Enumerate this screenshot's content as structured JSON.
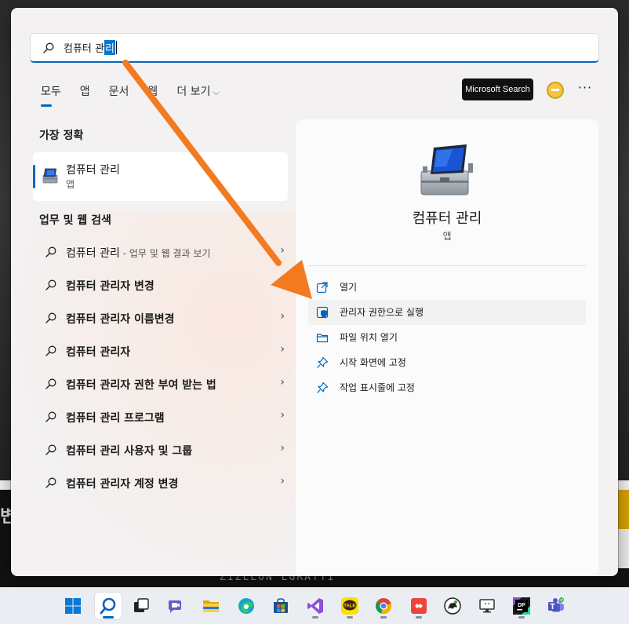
{
  "search": {
    "query_prefix": "컴퓨터 관",
    "query_selected": "리"
  },
  "tabs": [
    {
      "label": "모두",
      "active": true
    },
    {
      "label": "앱",
      "active": false
    },
    {
      "label": "문서",
      "active": false
    },
    {
      "label": "웹",
      "active": false
    },
    {
      "label": "더 보기",
      "active": false,
      "chevron": "⌵"
    }
  ],
  "header": {
    "ms_search_label": "Microsoft Search",
    "more_label": "···"
  },
  "best_match": {
    "section_title": "가장 정확",
    "title": "컴퓨터 관리",
    "subtitle": "앱"
  },
  "web_search": {
    "section_title": "업무 및 웹 검색",
    "items": [
      {
        "label": "컴퓨터 관리",
        "extra": " - 업무 및 웹 결과 보기",
        "bold": false
      },
      {
        "label": "컴퓨터 관리자 변경",
        "extra": "",
        "bold": true
      },
      {
        "label": "컴퓨터 관리자 이름변경",
        "extra": "",
        "bold": true
      },
      {
        "label": "컴퓨터 관리자",
        "extra": "",
        "bold": true
      },
      {
        "label": "컴퓨터 관리자 권한 부여 받는 법",
        "extra": "",
        "bold": true
      },
      {
        "label": "컴퓨터 관리 프로그램",
        "extra": "",
        "bold": true
      },
      {
        "label": "컴퓨터 관리 사용자 및 그룹",
        "extra": "",
        "bold": true
      },
      {
        "label": "컴퓨터 관리자 계정 변경",
        "extra": "",
        "bold": true
      }
    ],
    "arrow_glyph": "›"
  },
  "preview": {
    "title": "컴퓨터 관리",
    "subtitle": "앱",
    "actions": [
      {
        "label": "열기",
        "icon": "open-external-icon"
      },
      {
        "label": "관리자 권한으로 실행",
        "icon": "admin-shield-icon"
      },
      {
        "label": "파일 위치 열기",
        "icon": "folder-icon"
      },
      {
        "label": "시작 화면에 고정",
        "icon": "pin-icon"
      },
      {
        "label": "작업 표시줄에 고정",
        "icon": "pin-icon"
      }
    ]
  },
  "background": {
    "left_glyphs": "변",
    "bottom_text": "ZIZLLON LGRATTI"
  },
  "taskbar": {
    "items": [
      {
        "name": "start-button",
        "icon": "windows-logo-icon"
      },
      {
        "name": "search-button",
        "icon": "search-icon",
        "active": true
      },
      {
        "name": "task-view-button",
        "icon": "task-view-icon"
      },
      {
        "name": "chat-button",
        "icon": "video-chat-icon"
      },
      {
        "name": "file-explorer-button",
        "icon": "folder-icon"
      },
      {
        "name": "edge-button",
        "icon": "edge-icon"
      },
      {
        "name": "store-button",
        "icon": "store-icon"
      },
      {
        "name": "visual-studio-button",
        "icon": "visual-studio-icon"
      },
      {
        "name": "kakaotalk-button",
        "icon": "kakaotalk-icon"
      },
      {
        "name": "chrome-button",
        "icon": "chrome-icon"
      },
      {
        "name": "anydesk-button",
        "icon": "remote-desktop-icon"
      },
      {
        "name": "inkscape-button",
        "icon": "app-icon"
      },
      {
        "name": "monitor-button",
        "icon": "monitor-icon"
      },
      {
        "name": "dataspell-button",
        "icon": "dp-icon"
      },
      {
        "name": "teams-button",
        "icon": "teams-icon"
      }
    ],
    "kakaotalk_label": "TALK",
    "dp_label": "DP"
  },
  "colors": {
    "accent": "#0067c0",
    "arrow": "#f47a20"
  }
}
